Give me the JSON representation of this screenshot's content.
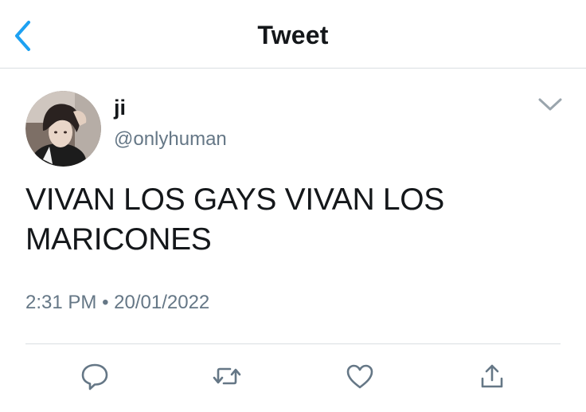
{
  "header": {
    "title": "Tweet",
    "back_icon": "chevron-left-icon"
  },
  "tweet": {
    "author": {
      "name": "ji",
      "handle": "@onlyhuman"
    },
    "text": "VIVAN LOS GAYS VIVAN LOS MARICONES",
    "time": "2:31 PM",
    "separator": "•",
    "date": "20/01/2022"
  },
  "actions": [
    {
      "icon": "reply-icon"
    },
    {
      "icon": "retweet-icon"
    },
    {
      "icon": "like-icon"
    },
    {
      "icon": "share-icon"
    }
  ],
  "colors": {
    "accent": "#1da1f2",
    "text": "#14171a",
    "secondary": "#657786",
    "divider": "#d9dee2"
  }
}
